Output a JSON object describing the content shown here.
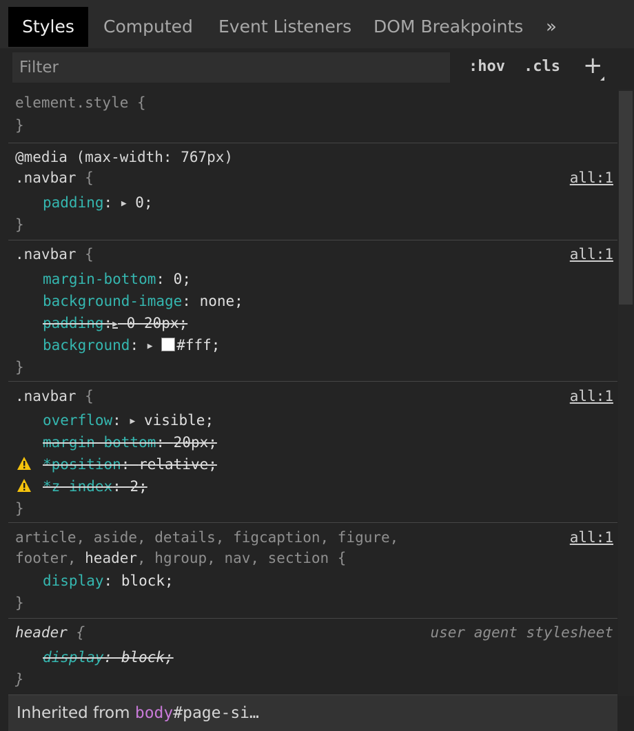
{
  "tabs": [
    {
      "label": "Styles",
      "active": true
    },
    {
      "label": "Computed",
      "active": false
    },
    {
      "label": "Event Listeners",
      "active": false
    },
    {
      "label": "DOM Breakpoints",
      "active": false
    }
  ],
  "tabs_overflow": "»",
  "filter": {
    "placeholder": "Filter",
    "value": ""
  },
  "toolbar": {
    "hov": ":hov",
    "cls": ".cls",
    "add": "+"
  },
  "rules": {
    "element_style": {
      "selector": "element.style",
      "open": "{",
      "close": "}"
    },
    "media_navbar": {
      "media": "@media (max-width: 767px)",
      "selector": ".navbar",
      "open": "{",
      "source": "all:1",
      "props": [
        {
          "name": "padding",
          "value": "0;"
        }
      ],
      "close": "}"
    },
    "navbar_1": {
      "selector": ".navbar",
      "open": "{",
      "source": "all:1",
      "props": [
        {
          "name": "margin-bottom",
          "value": "0;"
        },
        {
          "name": "background-image",
          "value": "none;"
        },
        {
          "name": "padding",
          "value": "0 20px;"
        },
        {
          "name": "background",
          "value": "#fff;"
        }
      ],
      "close": "}"
    },
    "navbar_2": {
      "selector": ".navbar",
      "open": "{",
      "source": "all:1",
      "props": [
        {
          "name": "overflow",
          "value": "visible;"
        },
        {
          "name": "margin-bottom",
          "value": "20px;"
        },
        {
          "name": "*position",
          "value": "relative;"
        },
        {
          "name": "*z-index",
          "value": "2;"
        }
      ],
      "close": "}"
    },
    "html5_block": {
      "selector_line1": "article, aside, details, figcaption, figure,",
      "selector_line2_a": "footer, ",
      "selector_line2_match": "header",
      "selector_line2_b": ", hgroup, nav, section {",
      "source": "all:1",
      "props": [
        {
          "name": "display",
          "value": "block;"
        }
      ],
      "close": "}"
    },
    "header_ua": {
      "selector": "header",
      "open": "{",
      "source": "user agent stylesheet",
      "props": [
        {
          "name": "display",
          "value": "block;"
        }
      ],
      "close": "}"
    }
  },
  "inherited": {
    "label": "Inherited from",
    "tag": "body",
    "id": "#page-si…"
  },
  "icons": {
    "warning": "warning-icon",
    "expand": "expand-triangle-icon",
    "swatch": "color-swatch-icon"
  },
  "colors": {
    "property": "#35b7b0",
    "tag": "#c87ad8",
    "warning": "#f4c20d",
    "background": "#242424"
  }
}
